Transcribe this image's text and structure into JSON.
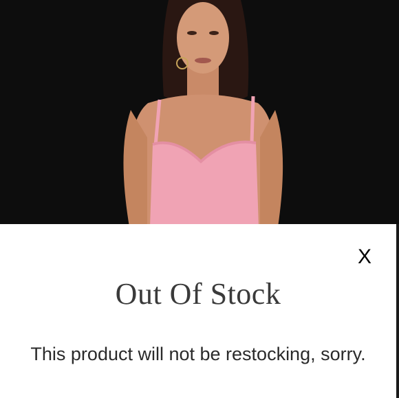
{
  "product": {
    "image_alt": "Model wearing pink bustier top",
    "dress_color": "#f0a3b4",
    "background_color": "#0d0d0d"
  },
  "modal": {
    "close_label": "X",
    "title": "Out Of Stock",
    "message": "This product will not be restocking, sorry."
  },
  "icons": {
    "close": "close-icon"
  }
}
